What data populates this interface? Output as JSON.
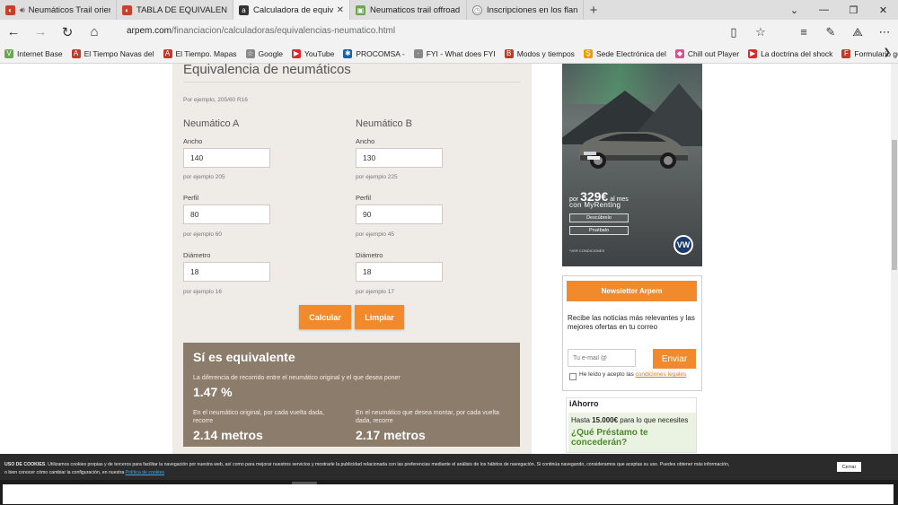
{
  "browser": {
    "tabs": [
      {
        "label": "Neumáticos Trail orient",
        "color": "#c8402a",
        "active": false
      },
      {
        "label": "TABLA DE EQUIVALENCIAS",
        "color": "#c8402a",
        "active": false
      },
      {
        "label": "Calculadora de equivale",
        "color": "#333333",
        "active": true
      },
      {
        "label": "Neumaticos trail offroad - E",
        "color": "#6aa84f",
        "active": false
      },
      {
        "label": "Inscripciones en los flancos",
        "color": "#888888",
        "active": false
      }
    ],
    "url_domain": "arpem.com",
    "url_path": "/financiacion/calculadoras/equivalencias-neumatico.html",
    "favorites": [
      {
        "label": "Internet Base",
        "color": "#6aa84f",
        "icon": "V"
      },
      {
        "label": "El Tiempo Navas del",
        "color": "#c0392b",
        "icon": "A"
      },
      {
        "label": "El Tiempo. Mapas",
        "color": "#c0392b",
        "icon": "A"
      },
      {
        "label": "Google",
        "color": "#888888",
        "icon": "☆"
      },
      {
        "label": "YouTube",
        "color": "#d92b2b",
        "icon": "▶"
      },
      {
        "label": "PROCOMSA -",
        "color": "#1d5fa3",
        "icon": "✱"
      },
      {
        "label": "FYI - What does FYI",
        "color": "#888888",
        "icon": "·"
      },
      {
        "label": "Modos y tiempos",
        "color": "#c0392b",
        "icon": "B"
      },
      {
        "label": "Sede Electrónica del",
        "color": "#e6a100",
        "icon": "Ş"
      },
      {
        "label": "Chill out Player",
        "color": "#d94f8f",
        "icon": "◆"
      },
      {
        "label": "La doctrina del shock",
        "color": "#d92b2b",
        "icon": "▶"
      },
      {
        "label": "Formulario genérico",
        "color": "#c0392b",
        "icon": "F"
      }
    ]
  },
  "calculator": {
    "title": "Equivalencia de neumáticos",
    "example": "Por ejemplo, 205/60 R16",
    "col_a_title": "Neumático A",
    "col_b_title": "Neumático B",
    "ancho_label": "Ancho",
    "perfil_label": "Perfil",
    "diametro_label": "Diámetro",
    "a": {
      "ancho": "140",
      "perfil": "80",
      "diametro": "18",
      "ancho_hint": "por ejemplo 205",
      "perfil_hint": "por ejemplo 60",
      "diametro_hint": "por ejemplo 16"
    },
    "b": {
      "ancho": "130",
      "perfil": "90",
      "diametro": "18",
      "ancho_hint": "por ejemplo 225",
      "perfil_hint": "por ejemplo 45",
      "diametro_hint": "por ejemplo 17"
    },
    "calc_button": "Calcular",
    "clear_button": "Limpiar",
    "accent": "#f08a2d"
  },
  "result": {
    "title": "Sí es equivalente",
    "diff_text": "La diferencia de recorrido entre el neumático original y el que desea poner",
    "diff_value": "1.47 %",
    "orig_text_1": "En el neumático original, por cada vuelta dada,",
    "orig_text_2": "recorre",
    "orig_value": "2.14 metros",
    "new_text_1": "En el neumático que desea montar, por cada vuelta",
    "new_text_2": "dada, recorre",
    "new_value": "2.17 metros"
  },
  "ad": {
    "price_pre": "por",
    "price": "329€",
    "price_suffix": "al mes",
    "brand": "con MyRenting",
    "btn1": "Descúbrelo",
    "btn2": "Pruébalo",
    "conditions": "*VER CONDICIONES",
    "logo": "VW"
  },
  "newsletter": {
    "title": "Newsletter Arpem",
    "text": "Recibe las noticias más relevantes y las mejores ofertas en tu correo",
    "email_placeholder": "Tu e-mail @",
    "send": "Enviar",
    "legal_pre": "He leído y acepto las",
    "legal_link": "condiciones legales"
  },
  "ahorro": {
    "logo": "iAhorro",
    "sub_pre": "Hasta",
    "sub_amount": "15.000€",
    "sub_post": "para lo que necesites",
    "question": "¿Qué Préstamo te concederán?"
  },
  "cookie": {
    "bold": "USO DE COOKIES",
    "text": ". Utilizamos cookies propias y de terceros para facilitar la navegación por nuestra web, así como para mejorar nuestros servicios y mostrarle la publicidad relacionada con las preferencias mediante el análisis de los hábitos de navegación. Si continúa navegando, consideramos que aceptas su uso. Puedes obtener más información,",
    "text2": "o bien conocer cómo cambiar la configuración, en nuestra",
    "link": "Política de cookies",
    "close": "Cerrar"
  }
}
